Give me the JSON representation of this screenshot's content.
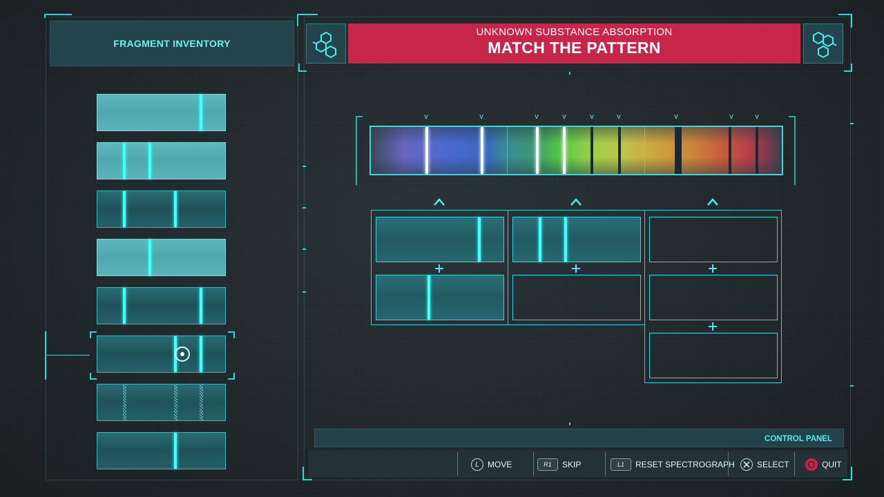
{
  "left_panel": {
    "title": "FRAGMENT INVENTORY",
    "selected_fragment_index": 5
  },
  "header": {
    "subtitle": "UNKNOWN SUBSTANCE ABSORPTION",
    "title": "MATCH THE PATTERN",
    "left_icon": "molecule-icon",
    "right_icon": "molecule-icon"
  },
  "control_panel": {
    "label": "CONTROL PANEL",
    "actions": [
      {
        "button": "L",
        "label": "MOVE"
      },
      {
        "button": "R1",
        "label": "SKIP"
      },
      {
        "button": "L1",
        "label": "RESET SPECTROGRAPH"
      },
      {
        "button": "cross",
        "label": "SELECT"
      },
      {
        "button": "circle",
        "label": "QUIT"
      }
    ]
  },
  "colors": {
    "accent": "#37d9df",
    "title_bar": "#c7254a",
    "quit_button": "#c8244a"
  }
}
